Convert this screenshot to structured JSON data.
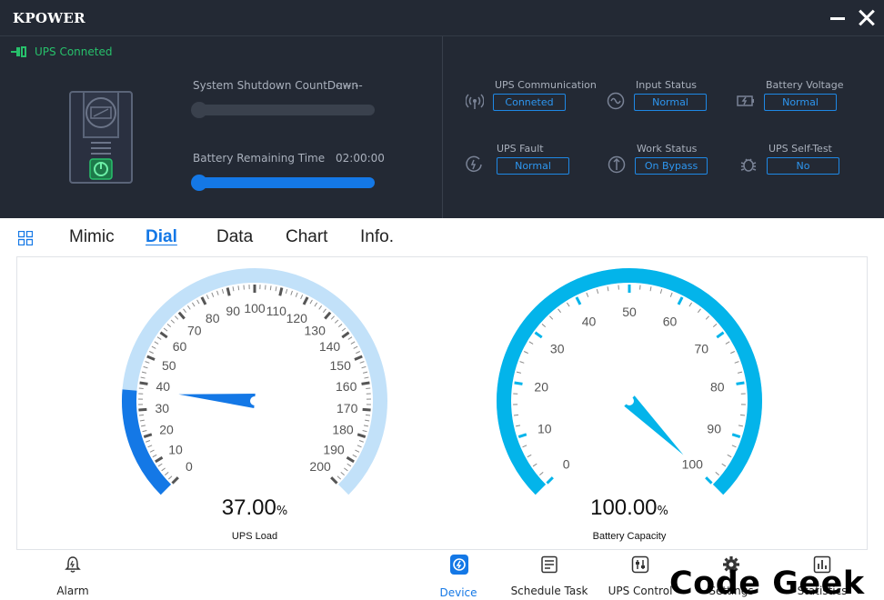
{
  "app": {
    "title": "KPOWER"
  },
  "window": {
    "minimize_icon": "minimize-icon",
    "close_icon": "close-icon"
  },
  "connection": {
    "text": "UPS Conneted",
    "color": "#27c06b"
  },
  "shutdown": {
    "label": "System Shutdown CountDown",
    "value": "-:--:--",
    "progress": 0
  },
  "battery_time": {
    "label": "Battery Remaining Time",
    "value": "02:00:00",
    "progress": 1.0
  },
  "status_items": [
    {
      "name": "UPS Communication",
      "value": "Conneted",
      "icon": "signal-icon"
    },
    {
      "name": "Input Status",
      "value": "Normal",
      "icon": "sine-wave-icon"
    },
    {
      "name": "Battery Voltage",
      "value": "Normal",
      "icon": "battery-charge-icon"
    },
    {
      "name": "UPS Fault",
      "value": "Normal",
      "icon": "fault-icon"
    },
    {
      "name": "Work Status",
      "value": "On Bypass",
      "icon": "bypass-icon"
    },
    {
      "name": "UPS Self-Test",
      "value": "No",
      "icon": "bug-icon"
    }
  ],
  "tabs": [
    {
      "label": "Mimic",
      "active": false
    },
    {
      "label": "Dial",
      "active": true
    },
    {
      "label": "Data",
      "active": false
    },
    {
      "label": "Chart",
      "active": false
    },
    {
      "label": "Info.",
      "active": false
    }
  ],
  "gauges": {
    "load": {
      "label": "UPS Load",
      "value_text": "37.00",
      "unit": "%",
      "value": 37,
      "min": 0,
      "max": 200,
      "ticks": [
        "0",
        "10",
        "20",
        "30",
        "40",
        "50",
        "60",
        "70",
        "80",
        "90",
        "100",
        "110",
        "120",
        "130",
        "140",
        "150",
        "160",
        "170",
        "180",
        "190",
        "200"
      ],
      "colors": {
        "track": "#c2e1f9",
        "fill": "#1478e6",
        "needle": "#1478e6"
      }
    },
    "battery": {
      "label": "Battery Capacity",
      "value_text": "100.00",
      "unit": "%",
      "value": 100,
      "min": 0,
      "max": 100,
      "ticks": [
        "0",
        "10",
        "20",
        "30",
        "40",
        "50",
        "60",
        "70",
        "80",
        "90",
        "100"
      ],
      "colors": {
        "track": "#c2e1f9",
        "fill": "#03b4ea",
        "needle": "#03b4ea"
      }
    }
  },
  "nav": [
    {
      "label": "Alarm",
      "icon": "alarm-bell-icon",
      "active": false
    },
    {
      "label": "Device",
      "icon": "device-icon",
      "active": true
    },
    {
      "label": "Schedule Task",
      "icon": "schedule-icon",
      "active": false
    },
    {
      "label": "UPS Control",
      "icon": "control-icon",
      "active": false
    },
    {
      "label": "Settings",
      "icon": "gear-icon",
      "active": false
    },
    {
      "label": "Statistics",
      "icon": "statistics-icon",
      "active": false
    }
  ],
  "watermark": {
    "text": "Code Geek"
  }
}
